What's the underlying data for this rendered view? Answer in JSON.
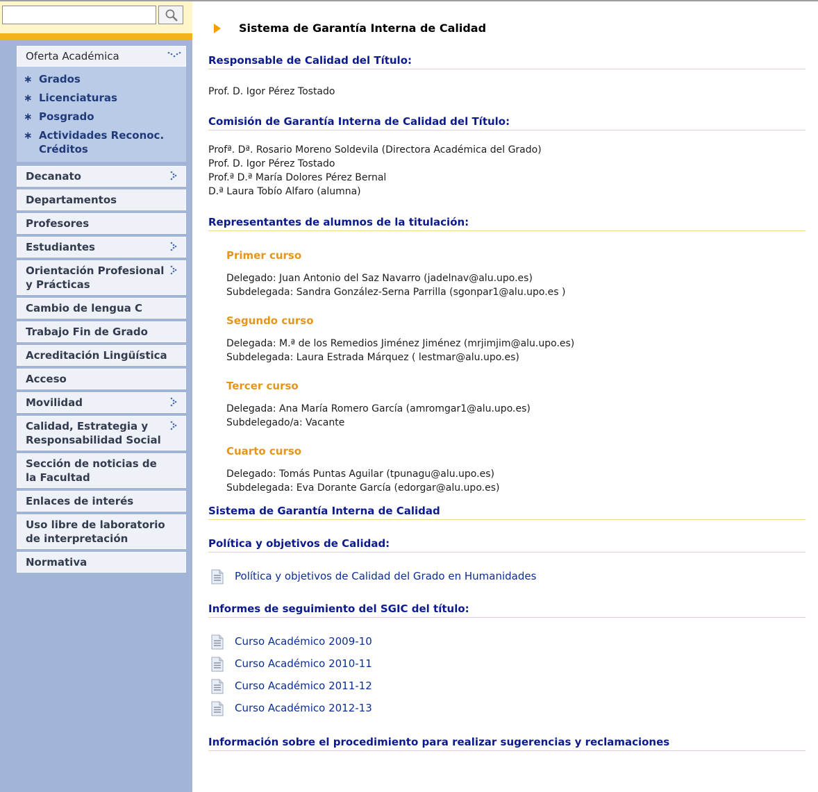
{
  "search": {
    "placeholder": ""
  },
  "sidebar": {
    "items": [
      {
        "label": "Oferta Académica",
        "has_arrow": true
      },
      {
        "label": "Decanato",
        "has_arrow": true
      },
      {
        "label": "Departamentos",
        "has_arrow": false
      },
      {
        "label": "Profesores",
        "has_arrow": false
      },
      {
        "label": "Estudiantes",
        "has_arrow": true
      },
      {
        "label": "Orientación Profesional y Prácticas",
        "has_arrow": true
      },
      {
        "label": "Cambio de lengua C",
        "has_arrow": false
      },
      {
        "label": "Trabajo Fin de Grado",
        "has_arrow": false
      },
      {
        "label": "Acreditación Lingüística",
        "has_arrow": false
      },
      {
        "label": "Acceso",
        "has_arrow": false
      },
      {
        "label": "Movilidad",
        "has_arrow": true
      },
      {
        "label": "Calidad, Estrategia y Responsabilidad Social",
        "has_arrow": true
      },
      {
        "label": "Sección de noticias de la Facultad",
        "has_arrow": false
      },
      {
        "label": "Enlaces de interés",
        "has_arrow": false
      },
      {
        "label": "Uso libre de laboratorio de interpretación",
        "has_arrow": false
      },
      {
        "label": "Normativa",
        "has_arrow": false
      }
    ],
    "submenu": [
      "Grados",
      "Licenciaturas",
      "Posgrado",
      "Actividades Reconoc. Créditos"
    ],
    "bullet": "∗"
  },
  "main": {
    "title": "Sistema de Garantía Interna de Calidad",
    "responsable": {
      "heading": "Responsable de Calidad del Título:",
      "name": "Prof. D. Igor Pérez Tostado"
    },
    "comision": {
      "heading": "Comisión de Garantía Interna de Calidad del Título:",
      "members": [
        "Profª. Dª. Rosario Moreno Soldevila (Directora Académica del Grado)",
        "Prof. D. Igor Pérez Tostado",
        "Prof.ª D.ª María Dolores Pérez Bernal",
        "D.ª Laura Tobío Alfaro (alumna)"
      ]
    },
    "representantes": {
      "heading": "Representantes de alumnos de la titulación:",
      "cursos": [
        {
          "name": "Primer curso",
          "lines": [
            "Delegado: Juan Antonio del Saz Navarro (jadelnav@alu.upo.es)",
            "Subdelegada: Sandra González-Serna Parrilla (sgonpar1@alu.upo.es )"
          ]
        },
        {
          "name": "Segundo curso",
          "lines": [
            "Delegada: M.ª de los Remedios Jiménez Jiménez (mrjimjim@alu.upo.es)",
            "Subdelegada: Laura Estrada Márquez ( lestmar@alu.upo.es)"
          ]
        },
        {
          "name": "Tercer curso",
          "lines": [
            "Delegada: Ana María Romero García (amromgar1@alu.upo.es)",
            "Subdelegado/a: Vacante"
          ]
        },
        {
          "name": "Cuarto curso",
          "lines": [
            "Delegado: Tomás Puntas Aguilar (tpunagu@alu.upo.es)",
            "Subdelegada: Eva Dorante García (edorgar@alu.upo.es)"
          ]
        }
      ]
    },
    "sgic_heading": "Sistema de Garantía Interna de Calidad",
    "politica": {
      "heading": "Política y objetivos de Calidad:",
      "link": "Política y objetivos de Calidad del Grado en Humanidades"
    },
    "informes": {
      "heading": "Informes de seguimiento del SGIC del título:",
      "links": [
        "Curso Académico 2009-10",
        "Curso Académico 2010-11",
        "Curso Académico 2011-12",
        "Curso Académico 2012-13"
      ]
    },
    "sugerencias_heading": "Información sobre el procedimiento para realizar sugerencias y reclamaciones"
  },
  "colors": {
    "sidebar_bg": "#a2b5d6",
    "accent_gold": "#f2b31a",
    "heading_blue": "#0c1b8c",
    "subheading_orange": "#e5961a"
  },
  "icons": {
    "search": "magnifier-icon",
    "title": "orange-triangle-icon",
    "arrows": "dotted-chevron-icon",
    "documents": "document-icon"
  }
}
